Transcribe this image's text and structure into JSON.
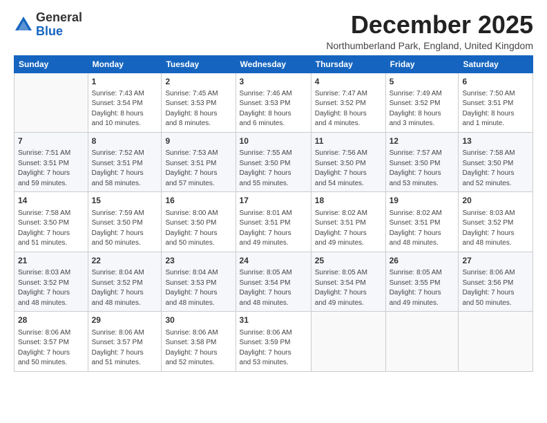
{
  "logo": {
    "general": "General",
    "blue": "Blue"
  },
  "title": "December 2025",
  "subtitle": "Northumberland Park, England, United Kingdom",
  "days_of_week": [
    "Sunday",
    "Monday",
    "Tuesday",
    "Wednesday",
    "Thursday",
    "Friday",
    "Saturday"
  ],
  "weeks": [
    [
      {
        "day": "",
        "info": ""
      },
      {
        "day": "1",
        "info": "Sunrise: 7:43 AM\nSunset: 3:54 PM\nDaylight: 8 hours\nand 10 minutes."
      },
      {
        "day": "2",
        "info": "Sunrise: 7:45 AM\nSunset: 3:53 PM\nDaylight: 8 hours\nand 8 minutes."
      },
      {
        "day": "3",
        "info": "Sunrise: 7:46 AM\nSunset: 3:53 PM\nDaylight: 8 hours\nand 6 minutes."
      },
      {
        "day": "4",
        "info": "Sunrise: 7:47 AM\nSunset: 3:52 PM\nDaylight: 8 hours\nand 4 minutes."
      },
      {
        "day": "5",
        "info": "Sunrise: 7:49 AM\nSunset: 3:52 PM\nDaylight: 8 hours\nand 3 minutes."
      },
      {
        "day": "6",
        "info": "Sunrise: 7:50 AM\nSunset: 3:51 PM\nDaylight: 8 hours\nand 1 minute."
      }
    ],
    [
      {
        "day": "7",
        "info": "Sunrise: 7:51 AM\nSunset: 3:51 PM\nDaylight: 7 hours\nand 59 minutes."
      },
      {
        "day": "8",
        "info": "Sunrise: 7:52 AM\nSunset: 3:51 PM\nDaylight: 7 hours\nand 58 minutes."
      },
      {
        "day": "9",
        "info": "Sunrise: 7:53 AM\nSunset: 3:51 PM\nDaylight: 7 hours\nand 57 minutes."
      },
      {
        "day": "10",
        "info": "Sunrise: 7:55 AM\nSunset: 3:50 PM\nDaylight: 7 hours\nand 55 minutes."
      },
      {
        "day": "11",
        "info": "Sunrise: 7:56 AM\nSunset: 3:50 PM\nDaylight: 7 hours\nand 54 minutes."
      },
      {
        "day": "12",
        "info": "Sunrise: 7:57 AM\nSunset: 3:50 PM\nDaylight: 7 hours\nand 53 minutes."
      },
      {
        "day": "13",
        "info": "Sunrise: 7:58 AM\nSunset: 3:50 PM\nDaylight: 7 hours\nand 52 minutes."
      }
    ],
    [
      {
        "day": "14",
        "info": "Sunrise: 7:58 AM\nSunset: 3:50 PM\nDaylight: 7 hours\nand 51 minutes."
      },
      {
        "day": "15",
        "info": "Sunrise: 7:59 AM\nSunset: 3:50 PM\nDaylight: 7 hours\nand 50 minutes."
      },
      {
        "day": "16",
        "info": "Sunrise: 8:00 AM\nSunset: 3:50 PM\nDaylight: 7 hours\nand 50 minutes."
      },
      {
        "day": "17",
        "info": "Sunrise: 8:01 AM\nSunset: 3:51 PM\nDaylight: 7 hours\nand 49 minutes."
      },
      {
        "day": "18",
        "info": "Sunrise: 8:02 AM\nSunset: 3:51 PM\nDaylight: 7 hours\nand 49 minutes."
      },
      {
        "day": "19",
        "info": "Sunrise: 8:02 AM\nSunset: 3:51 PM\nDaylight: 7 hours\nand 48 minutes."
      },
      {
        "day": "20",
        "info": "Sunrise: 8:03 AM\nSunset: 3:52 PM\nDaylight: 7 hours\nand 48 minutes."
      }
    ],
    [
      {
        "day": "21",
        "info": "Sunrise: 8:03 AM\nSunset: 3:52 PM\nDaylight: 7 hours\nand 48 minutes."
      },
      {
        "day": "22",
        "info": "Sunrise: 8:04 AM\nSunset: 3:52 PM\nDaylight: 7 hours\nand 48 minutes."
      },
      {
        "day": "23",
        "info": "Sunrise: 8:04 AM\nSunset: 3:53 PM\nDaylight: 7 hours\nand 48 minutes."
      },
      {
        "day": "24",
        "info": "Sunrise: 8:05 AM\nSunset: 3:54 PM\nDaylight: 7 hours\nand 48 minutes."
      },
      {
        "day": "25",
        "info": "Sunrise: 8:05 AM\nSunset: 3:54 PM\nDaylight: 7 hours\nand 49 minutes."
      },
      {
        "day": "26",
        "info": "Sunrise: 8:05 AM\nSunset: 3:55 PM\nDaylight: 7 hours\nand 49 minutes."
      },
      {
        "day": "27",
        "info": "Sunrise: 8:06 AM\nSunset: 3:56 PM\nDaylight: 7 hours\nand 50 minutes."
      }
    ],
    [
      {
        "day": "28",
        "info": "Sunrise: 8:06 AM\nSunset: 3:57 PM\nDaylight: 7 hours\nand 50 minutes."
      },
      {
        "day": "29",
        "info": "Sunrise: 8:06 AM\nSunset: 3:57 PM\nDaylight: 7 hours\nand 51 minutes."
      },
      {
        "day": "30",
        "info": "Sunrise: 8:06 AM\nSunset: 3:58 PM\nDaylight: 7 hours\nand 52 minutes."
      },
      {
        "day": "31",
        "info": "Sunrise: 8:06 AM\nSunset: 3:59 PM\nDaylight: 7 hours\nand 53 minutes."
      },
      {
        "day": "",
        "info": ""
      },
      {
        "day": "",
        "info": ""
      },
      {
        "day": "",
        "info": ""
      }
    ]
  ]
}
